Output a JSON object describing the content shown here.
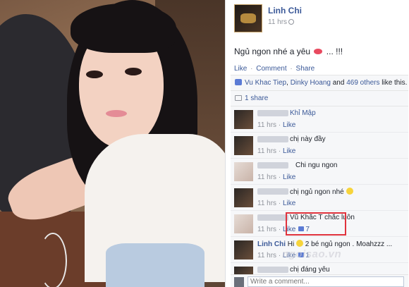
{
  "post": {
    "author": "Linh Chi",
    "time": "11 hrs",
    "text": "Ngủ ngon nhé a yêu",
    "text_suffix": " ... !!!",
    "actions": {
      "like": "Like",
      "comment": "Comment",
      "share": "Share",
      "separator": "·"
    }
  },
  "feedback": {
    "likes_name1": "Vu Khac Tiep",
    "likes_sep": ", ",
    "likes_name2": "Dinky Hoang",
    "likes_and": " and ",
    "likes_others": "469 others",
    "likes_suffix": " like this.",
    "shares": "1 share"
  },
  "comments": [
    {
      "text": "Khỉ Mập",
      "text_blue": true,
      "time": "11 hrs",
      "like": "Like",
      "likes": ""
    },
    {
      "text": "chị này đầy",
      "time": "11 hrs",
      "like": "Like",
      "likes": ""
    },
    {
      "text": "Chi ngu ngon",
      "time": "11 hrs",
      "like": "Like",
      "likes": ""
    },
    {
      "text": "chị ngủ ngon nhé",
      "time": "11 hrs",
      "like": "Like",
      "likes": ""
    },
    {
      "text": "Vũ Khắc T chắc luôn",
      "time": "11 hrs",
      "like": "Like",
      "likes": "7",
      "highlighted": true
    },
    {
      "author": "Linh Chi",
      "text": "Hi",
      "text2": " 2 bé ngủ ngon . Moahzzz ...",
      "time": "11 hrs",
      "like": "Like",
      "likes": "1"
    },
    {
      "text": "chị đáng yêu",
      "time": "",
      "like": "",
      "likes": ""
    }
  ],
  "composer": {
    "placeholder": "Write a comment..."
  },
  "watermark": "ngoisao.vn",
  "colors": {
    "link": "#3b5998",
    "highlight_box": "#e0333d",
    "meta": "#90949c"
  }
}
